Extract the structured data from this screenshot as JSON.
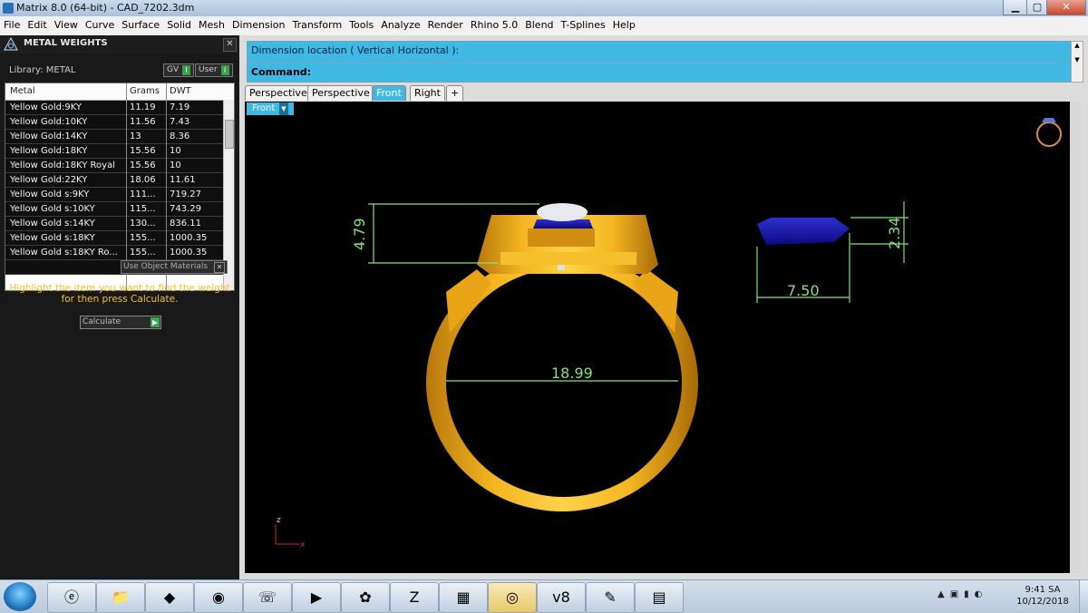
{
  "window": {
    "title": "Matrix 8.0 (64-bit) - CAD_7202.3dm",
    "min": "▁",
    "max": "▢",
    "close": "✕"
  },
  "menu": [
    "File",
    "Edit",
    "View",
    "Curve",
    "Surface",
    "Solid",
    "Mesh",
    "Dimension",
    "Transform",
    "Tools",
    "Analyze",
    "Render",
    "Rhino 5.0",
    "Blend",
    "T-Splines",
    "Help"
  ],
  "panel": {
    "title": "METAL WEIGHTS",
    "close": "✕",
    "library_label": "Library: METAL",
    "gv_label": "GV",
    "user_label": "User",
    "columns": [
      "Metal",
      "Grams",
      "DWT"
    ],
    "rows": [
      [
        "Yellow Gold:9KY",
        "11.19",
        "7.19"
      ],
      [
        "Yellow Gold:10KY",
        "11.56",
        "7.43"
      ],
      [
        "Yellow Gold:14KY",
        "13",
        "8.36"
      ],
      [
        "Yellow Gold:18KY",
        "15.56",
        "10"
      ],
      [
        "Yellow Gold:18KY Royal",
        "15.56",
        "10"
      ],
      [
        "Yellow Gold:22KY",
        "18.06",
        "11.61"
      ],
      [
        "Yellow Gold s:9KY",
        "111...",
        "719.27"
      ],
      [
        "Yellow Gold s:10KY",
        "115...",
        "743.29"
      ],
      [
        "Yellow Gold s:14KY",
        "130...",
        "836.11"
      ],
      [
        "Yellow Gold s:18KY",
        "155...",
        "1000.35"
      ],
      [
        "Yellow Gold s:18KY Ro...",
        "155...",
        "1000.35"
      ]
    ],
    "use_object_materials": "Use Object Materials",
    "instruction": "Highlight the item you want to find the weight for then press Calculate.",
    "calculate": "Calculate"
  },
  "command": {
    "line1": "Dimension location ( Vertical  Horizontal ):",
    "line2": "Command:"
  },
  "tabs": [
    "Perspective",
    "Perspective",
    "Front",
    "Right",
    "+"
  ],
  "active_tab": 2,
  "viewport": {
    "label": "Front",
    "dimensions": {
      "ring_inner": "18.99",
      "head_height": "4.79",
      "stone_width": "7.50",
      "stone_height": "2.34"
    },
    "axis_z": "z",
    "axis_x": "x"
  },
  "taskbar": {
    "apps": [
      "ie",
      "explorer",
      "game",
      "chrome",
      "viber",
      "media",
      "corel",
      "zalo",
      "teamviewer",
      "matrix",
      "v8",
      "paint",
      "notes"
    ],
    "time": "9:41 SA",
    "date": "10/12/2018"
  },
  "colors": {
    "accent": "#3fb8e3",
    "gold": "#f2b01e",
    "dimension": "#86e07a",
    "stone": "#1a1aa8"
  }
}
